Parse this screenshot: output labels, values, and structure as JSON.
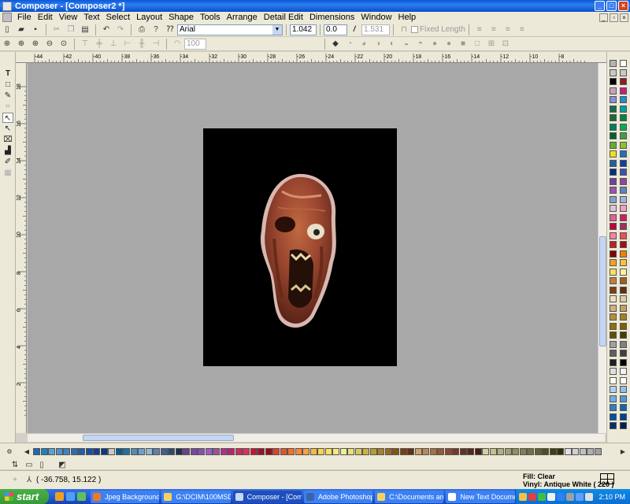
{
  "window": {
    "title": "Composer - [Composer2 *]"
  },
  "menu": [
    "File",
    "Edit",
    "View",
    "Text",
    "Select",
    "Layout",
    "Shape",
    "Tools",
    "Arrange",
    "Detail Edit",
    "Dimensions",
    "Window",
    "Help"
  ],
  "toolbar": {
    "font_name": "Arial",
    "font_size": "1.042",
    "spacing": "0.0",
    "char_width": "1.531",
    "fixed_length_label": "Fixed Length",
    "zoom_value": "100"
  },
  "ruler": {
    "top_ticks": [
      "-44",
      "-42",
      "-40",
      "-38",
      "-36",
      "-34",
      "-32",
      "-30",
      "-28",
      "-26",
      "-24",
      "-22",
      "-20",
      "-18",
      "-16",
      "-14",
      "-12",
      "-10",
      "-8"
    ],
    "left_ticks": [
      "18",
      "16",
      "14",
      "12",
      "10",
      "8",
      "6",
      "4",
      "2"
    ]
  },
  "status": {
    "coordinates": "( -36.758, 15.122 )",
    "fill": "Fill: Clear",
    "vinyl": "Vinyl: Antique White ( 220 )"
  },
  "taskbar": {
    "start": "start",
    "tasks": [
      {
        "label": "Jpeg Background - ...",
        "color": "#f07a20"
      },
      {
        "label": "G:\\DCIM\\100MSDCF",
        "color": "#f7d25b"
      },
      {
        "label": "Composer - [Comp...",
        "color": "#c5d8f0"
      },
      {
        "label": "Adobe Photoshop",
        "color": "#3c64a8"
      },
      {
        "label": "C:\\Documents and ...",
        "color": "#f7d25b"
      },
      {
        "label": "New Text Documen...",
        "color": "#ffffff"
      }
    ],
    "clock": "2:10 PM"
  },
  "palette": {
    "right_colors": [
      "#b4b4b4",
      "#fff",
      "#c8c8c8",
      "#c8c8c8",
      "#000",
      "#8a2020",
      "#c8a0c0",
      "#c02080",
      "#8890d8",
      "#1e90c8",
      "#1a6a48",
      "#00a0a0",
      "#206838",
      "#0e8040",
      "#008060",
      "#00b050",
      "#006030",
      "#40a040",
      "#60b030",
      "#90c030",
      "#f0e020",
      "#1e70c0",
      "#2060a8",
      "#1040a0",
      "#003080",
      "#4050b0",
      "#7040a0",
      "#9a40a0",
      "#a050b0",
      "#6080c0",
      "#80a0d0",
      "#a0b0e0",
      "#e0c0e0",
      "#f0a0c0",
      "#e06090",
      "#d02060",
      "#c00040",
      "#a03060",
      "#ff80a0",
      "#f05050",
      "#c02020",
      "#a01010",
      "#800000",
      "#f08000",
      "#f8a020",
      "#ffc040",
      "#fde060",
      "#fff0a0",
      "#c08040",
      "#a06020",
      "#804010",
      "#603010",
      "#f0e0c0",
      "#e0c8a0",
      "#d0b080",
      "#c0a060",
      "#b09040",
      "#a08020",
      "#907010",
      "#806000",
      "#605000",
      "#404000",
      "#a0a0a0",
      "#808080",
      "#606060",
      "#404040",
      "#202020",
      "#000000",
      "#e0e0e0",
      "#f0f0f0",
      "#fffff0",
      "#ffffff",
      "#b0d0f0",
      "#90c0e8",
      "#70b0e0",
      "#5098d0",
      "#3080c0",
      "#1068b0",
      "#0050a0",
      "#004090",
      "#003070",
      "#002050",
      "#001030",
      "#600060",
      "#800080"
    ],
    "bottom_colors": [
      "#1e6ab0",
      "#2080c0",
      "#60a0d0",
      "#5090c8",
      "#4080c0",
      "#306cb0",
      "#2060a8",
      "#1850a0",
      "#104090",
      "#0c3880",
      "#c8c8c8",
      "#0a5a90",
      "#2070a0",
      "#508cb8",
      "#70a0c8",
      "#90b8d8",
      "#6080a8",
      "#405f90",
      "#304870",
      "#203050",
      "#6a4090",
      "#7848a0",
      "#8850b0",
      "#9a60c0",
      "#a050a0",
      "#b03088",
      "#c02070",
      "#d02860",
      "#e03050",
      "#c01838",
      "#a01028",
      "#901018",
      "#e04030",
      "#e05828",
      "#f07028",
      "#f88838",
      "#f8a040",
      "#f8b848",
      "#fcd050",
      "#fce060",
      "#f8e880",
      "#f0f098",
      "#e8e078",
      "#d8c860",
      "#c8b048",
      "#b89838",
      "#a88028",
      "#986820",
      "#885018",
      "#784010",
      "#683010",
      "#c8a070",
      "#b88858",
      "#a87048",
      "#985838",
      "#884830",
      "#783828",
      "#683020",
      "#582818",
      "#482010",
      "#d0d0a0",
      "#c0c090",
      "#b0b080",
      "#a0a070",
      "#909060",
      "#808050",
      "#707040",
      "#606030",
      "#505020",
      "#404010",
      "#303008",
      "#e0e0e0",
      "#d0d0d0",
      "#c0c0c0",
      "#b0b0b0",
      "#a0a0a0"
    ]
  }
}
